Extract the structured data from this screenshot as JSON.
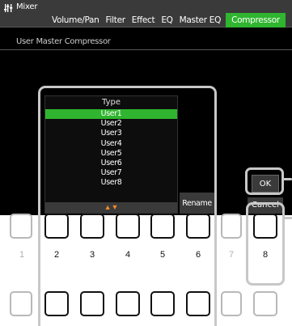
{
  "header": {
    "app_title": "Mixer",
    "tabs": [
      "Volume/Pan",
      "Filter",
      "Effect",
      "EQ",
      "Master EQ",
      "Compressor"
    ],
    "active_tab": "Compressor"
  },
  "subtitle": "User Master Compressor",
  "type_list": {
    "header": "Type",
    "items": [
      "User1",
      "User2",
      "User3",
      "User4",
      "User5",
      "User6",
      "User7",
      "User8"
    ],
    "selected": "User1",
    "scroll_arrows": "▲▼"
  },
  "buttons": {
    "rename": "Rename",
    "ok": "OK",
    "cancel": "Cancel"
  },
  "panel_buttons": {
    "labels": [
      "1",
      "2",
      "3",
      "4",
      "5",
      "6",
      "7",
      "8"
    ]
  },
  "colors": {
    "accent_green": "#2fb52f",
    "arrow_orange": "#f08a2a",
    "highlight_frame": "#c8c8c8"
  }
}
